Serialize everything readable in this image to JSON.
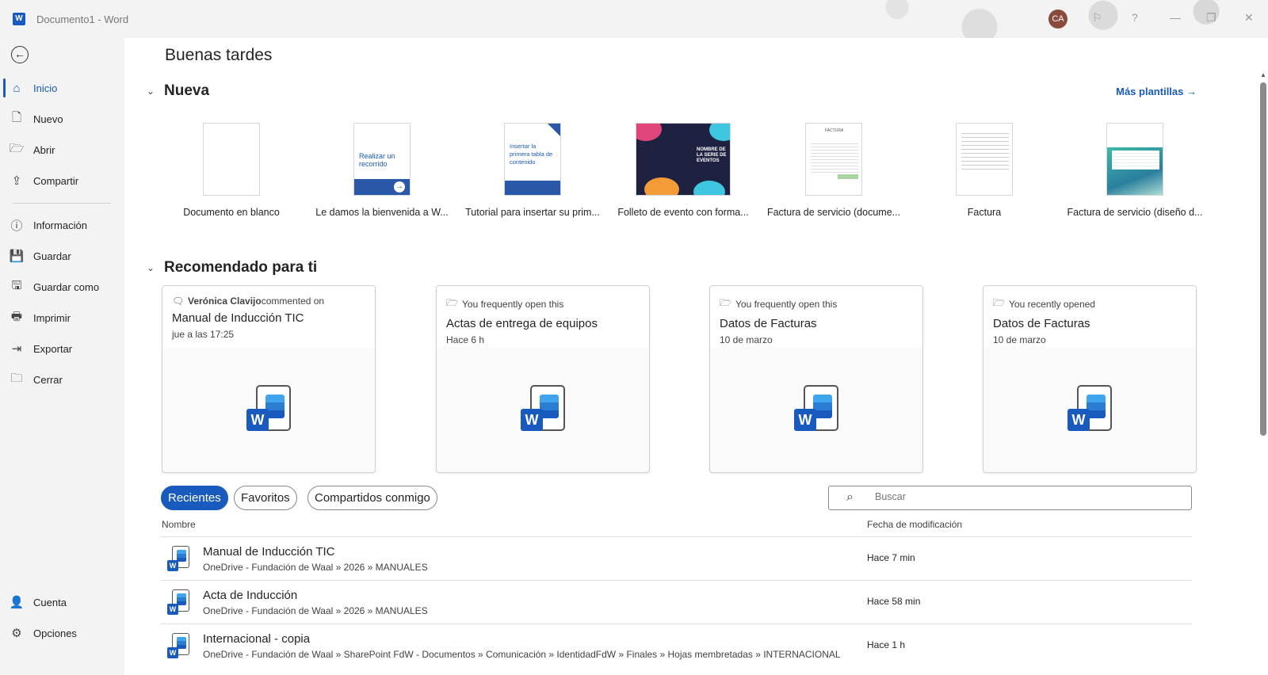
{
  "titlebar": {
    "app_logo": "W",
    "doc_title": "Documento1  -  Word",
    "avatar_initials": "CA"
  },
  "sidebar": {
    "items": [
      {
        "label": "Inicio",
        "icon": "home-icon",
        "glyph": "⌂"
      },
      {
        "label": "Nuevo",
        "icon": "new-doc-icon",
        "glyph": "🗋"
      },
      {
        "label": "Abrir",
        "icon": "open-folder-icon",
        "glyph": "🗁"
      },
      {
        "label": "Compartir",
        "icon": "share-icon",
        "glyph": "⇪"
      },
      {
        "label": "Información",
        "icon": "info-icon",
        "glyph": "ⓘ"
      },
      {
        "label": "Guardar",
        "icon": "save-icon",
        "glyph": "💾"
      },
      {
        "label": "Guardar como",
        "icon": "save-as-icon",
        "glyph": "🖫"
      },
      {
        "label": "Imprimir",
        "icon": "print-icon",
        "glyph": "🖶"
      },
      {
        "label": "Exportar",
        "icon": "export-icon",
        "glyph": "⇥"
      },
      {
        "label": "Cerrar",
        "icon": "close-folder-icon",
        "glyph": "🗀"
      }
    ],
    "bottom": [
      {
        "label": "Cuenta",
        "icon": "account-icon",
        "glyph": "👤"
      },
      {
        "label": "Opciones",
        "icon": "options-icon",
        "glyph": "⚙"
      }
    ]
  },
  "main": {
    "greeting": "Buenas tardes",
    "new_section": "Nueva",
    "more_templates": "Más plantillas",
    "templates": [
      {
        "label": "Documento en blanco",
        "thumb_text": ""
      },
      {
        "label": "Le damos la bienvenida a W...",
        "thumb_text": "Realizar un recorrido"
      },
      {
        "label": "Tutorial para insertar su prim...",
        "thumb_text": "Insertar la primera tabla de contenido"
      },
      {
        "label": "Folleto de evento con forma...",
        "thumb_text": "NOMBRE DE LA SERIE DE EVENTOS"
      },
      {
        "label": "Factura de servicio (docume...",
        "thumb_text": "FACTURA"
      },
      {
        "label": "Factura",
        "thumb_text": ""
      },
      {
        "label": "Factura de servicio (diseño d...",
        "thumb_text": ""
      }
    ],
    "recommended_section": "Recomendado para ti",
    "cards": [
      {
        "reason_bold": "Verónica Clavijo",
        "reason": " commented on",
        "reason_icon": "comment-icon",
        "title": "Manual de Inducción TIC",
        "sub": "jue a las 17:25"
      },
      {
        "reason_bold": "",
        "reason": "You frequently open this",
        "reason_icon": "folder-icon",
        "title": "Actas de entrega de equipos",
        "sub": "Hace 6 h"
      },
      {
        "reason_bold": "",
        "reason": "You frequently open this",
        "reason_icon": "folder-icon",
        "title": "Datos de Facturas",
        "sub": "10 de marzo"
      },
      {
        "reason_bold": "",
        "reason": "You recently opened",
        "reason_icon": "folder-icon",
        "title": "Datos de Facturas",
        "sub": "10 de marzo"
      }
    ],
    "filters": [
      "Recientes",
      "Favoritos",
      "Compartidos conmigo"
    ],
    "search_placeholder": "Buscar",
    "columns": {
      "name": "Nombre",
      "date": "Fecha de modificación"
    },
    "files": [
      {
        "name": "Manual de Inducción TIC",
        "path": "OneDrive - Fundación de Waal » 2026 » MANUALES",
        "date": "Hace 7 min"
      },
      {
        "name": "Acta de Inducción",
        "path": "OneDrive - Fundación de Waal » 2026 » MANUALES",
        "date": "Hace 58 min"
      },
      {
        "name": "Internacional - copia",
        "path": "OneDrive - Fundación de Waal » SharePoint FdW - Documentos » Comunicación » IdentidadFdW » Finales » Hojas membretadas » INTERNACIONAL",
        "date": "Hace 1 h"
      }
    ]
  },
  "colors": {
    "accent": "#185abd",
    "sidebar_bg": "#f3f3f3"
  }
}
